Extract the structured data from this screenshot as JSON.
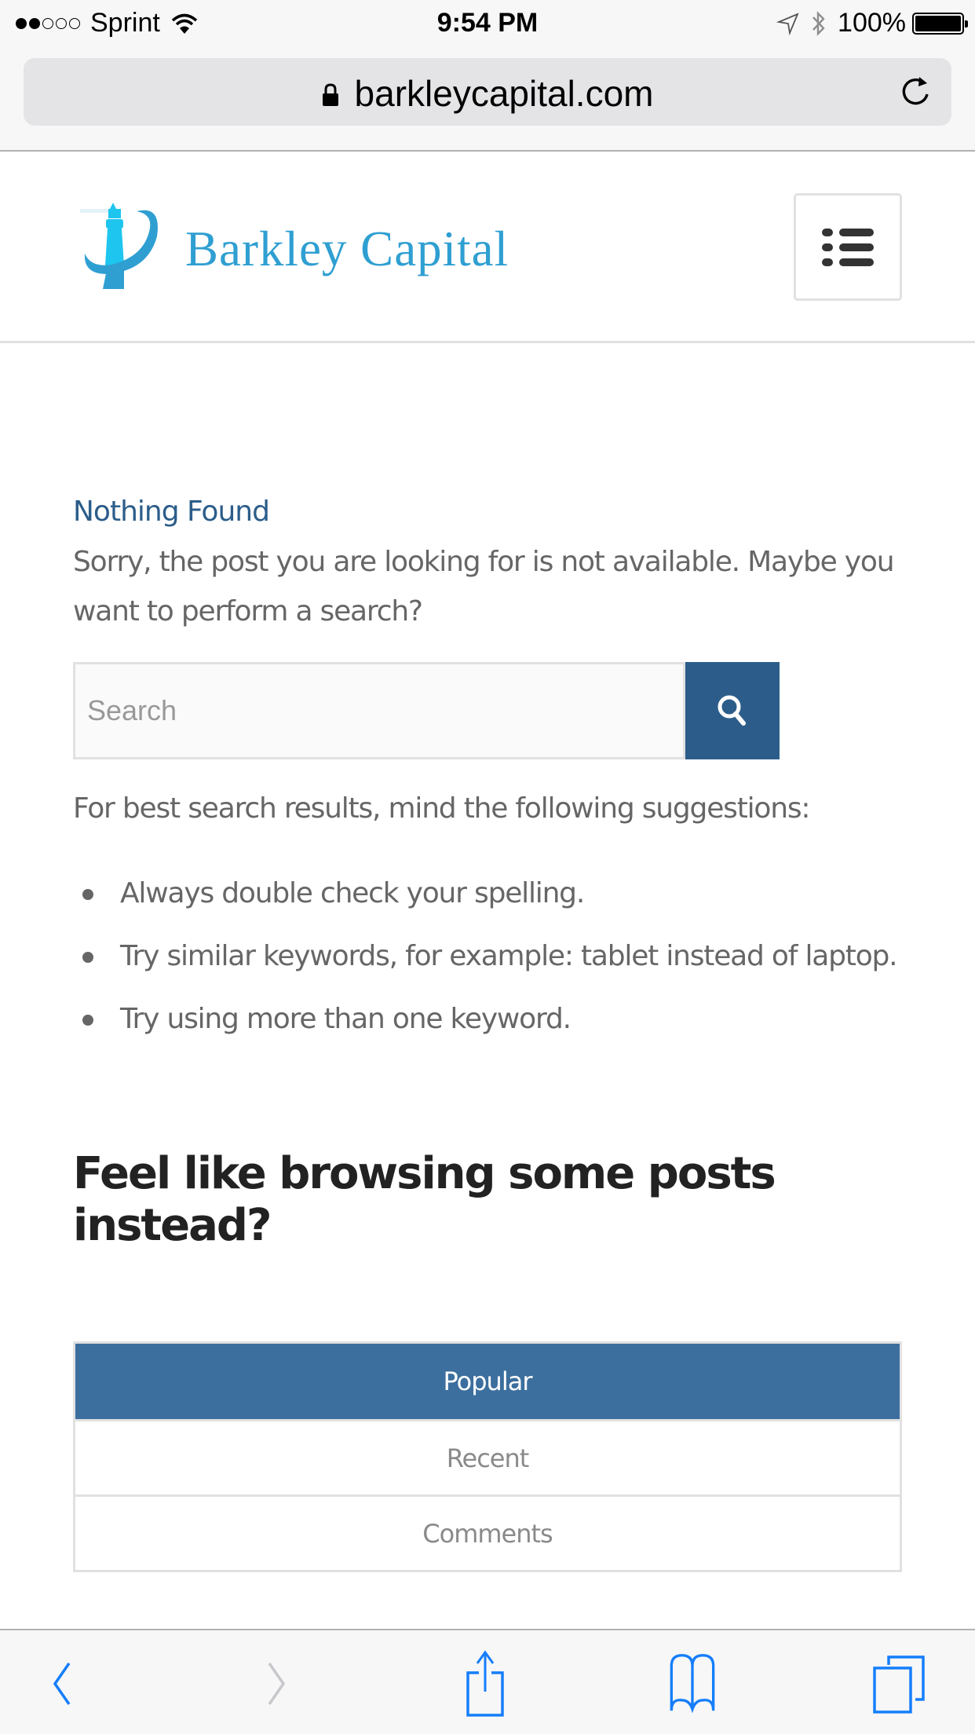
{
  "status_bar": {
    "signal_bars_filled": 2,
    "signal_bars_total": 5,
    "carrier": "Sprint",
    "time": "9:54 PM",
    "battery": "100%",
    "battery_level": 1.0
  },
  "browser": {
    "url": "barkleycapital.com",
    "secure": true
  },
  "header": {
    "logo_text": "Barkley Capital",
    "logo_color": "#2f9fd2"
  },
  "main": {
    "title": "Nothing Found",
    "message": "Sorry, the post you are looking for is not available. Maybe you want to perform a search?",
    "search": {
      "placeholder": "Search",
      "value": ""
    },
    "hint": "For best search results, mind the following suggestions:",
    "suggestions": [
      "Always double check your spelling.",
      "Try similar keywords, for example: tablet instead of laptop.",
      "Try using more than one keyword."
    ],
    "browse_title": "Feel like browsing some posts instead?",
    "tabs": [
      {
        "label": "Popular",
        "active": true
      },
      {
        "label": "Recent",
        "active": false
      },
      {
        "label": "Comments",
        "active": false
      }
    ],
    "accent_color": "#2c5d8a"
  },
  "toolbar": {
    "icons": [
      "back-icon",
      "forward-icon",
      "share-icon",
      "bookmarks-icon",
      "tabs-icon"
    ],
    "accent_color": "#157efb"
  }
}
